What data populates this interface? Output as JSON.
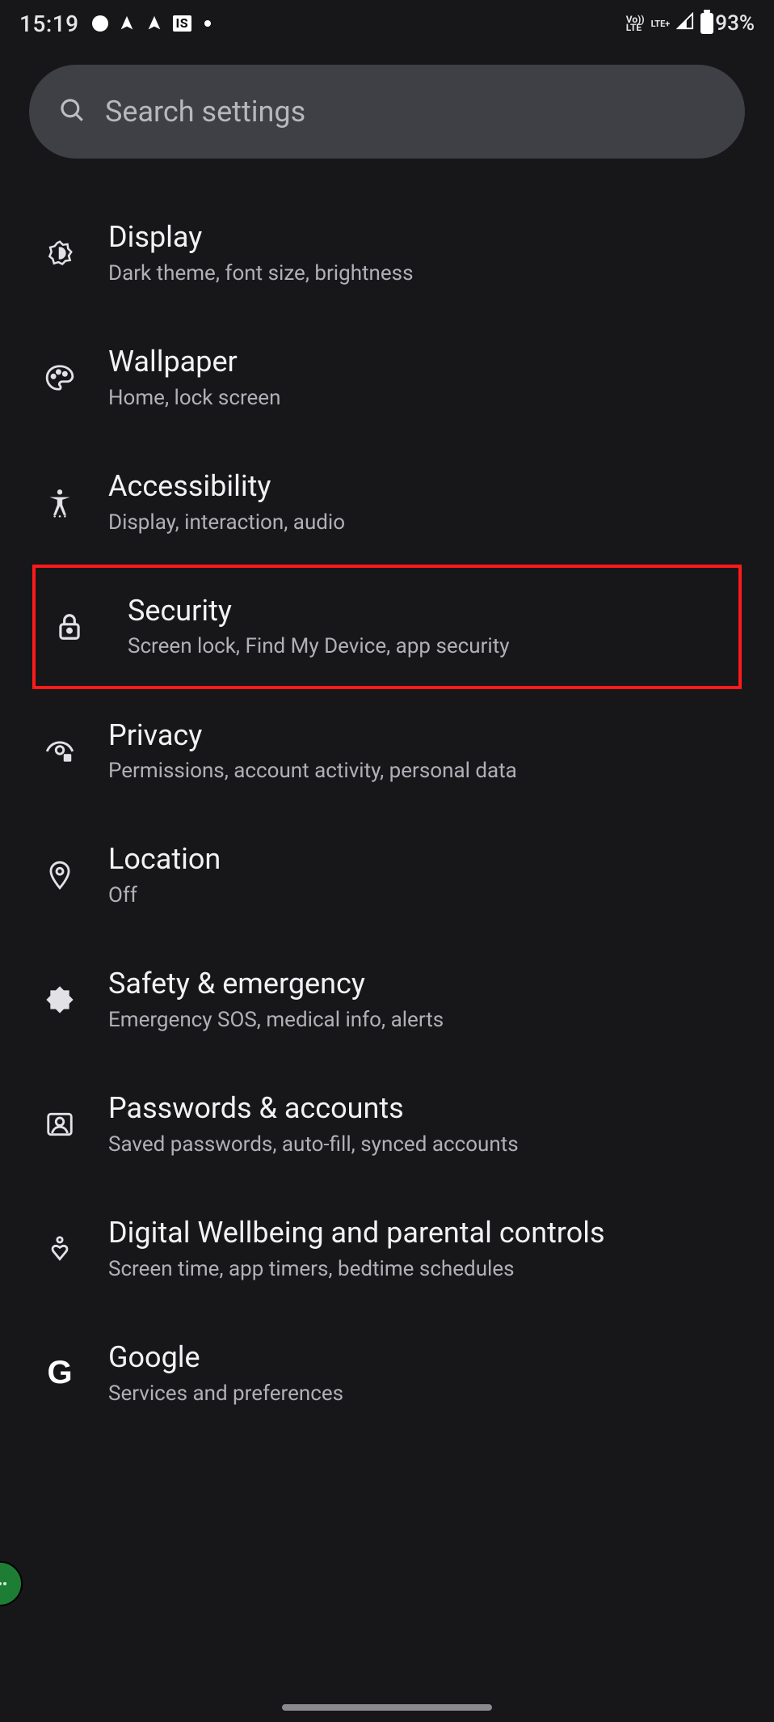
{
  "status": {
    "time": "15:19",
    "is_badge": "IS",
    "net_top": "Vo))",
    "net_bottom": "LTE",
    "lte_plus": "LTE+",
    "battery_pct": "93%"
  },
  "search": {
    "placeholder": "Search settings"
  },
  "settings": [
    {
      "key": "display",
      "icon": "brightness-icon",
      "title": "Display",
      "subtitle": "Dark theme, font size, brightness"
    },
    {
      "key": "wallpaper",
      "icon": "palette-icon",
      "title": "Wallpaper",
      "subtitle": "Home, lock screen"
    },
    {
      "key": "accessibility",
      "icon": "accessibility-icon",
      "title": "Accessibility",
      "subtitle": "Display, interaction, audio"
    },
    {
      "key": "security",
      "icon": "lock-icon",
      "title": "Security",
      "subtitle": "Screen lock, Find My Device, app security",
      "highlighted": true
    },
    {
      "key": "privacy",
      "icon": "privacy-eye-icon",
      "title": "Privacy",
      "subtitle": "Permissions, account activity, personal data"
    },
    {
      "key": "location",
      "icon": "location-pin-icon",
      "title": "Location",
      "subtitle": "Off"
    },
    {
      "key": "safety",
      "icon": "medical-icon",
      "title": "Safety & emergency",
      "subtitle": "Emergency SOS, medical info, alerts"
    },
    {
      "key": "passwords",
      "icon": "account-box-icon",
      "title": "Passwords & accounts",
      "subtitle": "Saved passwords, auto-fill, synced accounts"
    },
    {
      "key": "wellbeing",
      "icon": "wellbeing-icon",
      "title": "Digital Wellbeing and parental controls",
      "subtitle": "Screen time, app timers, bedtime schedules"
    },
    {
      "key": "google",
      "icon": "google-g-icon",
      "title": "Google",
      "subtitle": "Services and preferences"
    }
  ]
}
